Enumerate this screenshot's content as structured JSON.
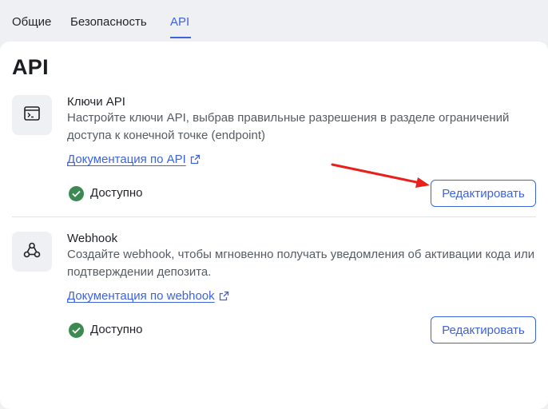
{
  "tabs": [
    {
      "label": "Общие",
      "active": false
    },
    {
      "label": "Безопасность",
      "active": false
    },
    {
      "label": "API",
      "active": true
    }
  ],
  "page_title": "API",
  "items": [
    {
      "icon": "terminal-icon",
      "title": "Ключи API",
      "description": "Настройте ключи API, выбрав правильные разрешения в разделе ограничений доступа к конечной точке (endpoint)",
      "doc_link": "Документация по API",
      "status": "Доступно",
      "edit_label": "Редактировать"
    },
    {
      "icon": "webhook-icon",
      "title": "Webhook",
      "description": "Создайте webhook, чтобы мгновенно получать уведомления об активации кода или подтверждении депозита.",
      "doc_link": "Документация по webhook",
      "status": "Доступно",
      "edit_label": "Редактировать"
    }
  ],
  "colors": {
    "accent": "#3d63dd",
    "status_ok": "#3c8a52",
    "annotation_arrow": "#e8201c",
    "background": "#eef0f3"
  }
}
